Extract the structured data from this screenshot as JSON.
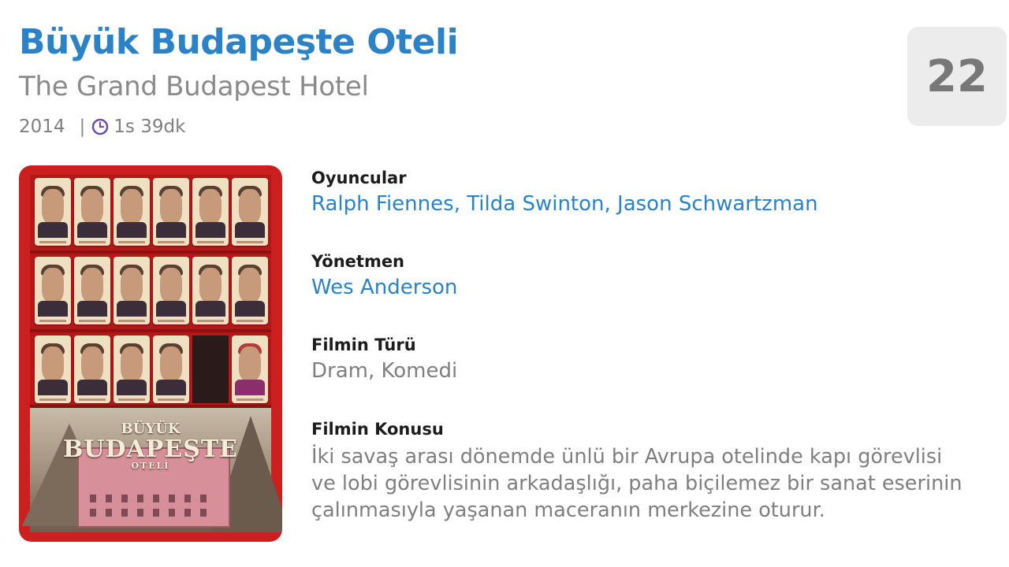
{
  "movie": {
    "title": "Büyük Budapeşte Oteli",
    "original_title": "The Grand Budapest Hotel",
    "year": "2014",
    "separator": "|",
    "duration": "1s 39dk",
    "score": "22"
  },
  "poster": {
    "title_line1": "BÜYÜK",
    "title_line2": "BUDAPEŞTE",
    "title_line3": "OTELİ"
  },
  "details": {
    "cast_label": "Oyuncular",
    "cast": [
      {
        "name": "Ralph Fiennes"
      },
      {
        "name": "Tilda Swinton"
      },
      {
        "name": "Jason Schwartzman"
      }
    ],
    "cast_separator": ", ",
    "director_label": "Yönetmen",
    "director": "Wes Anderson",
    "genre_label": "Filmin Türü",
    "genre": "Dram, Komedi",
    "plot_label": "Filmin Konusu",
    "plot_lines": [
      "İki savaş arası dönemde ünlü bir Avrupa otelinde kapı görevlisi",
      "ve lobi görevlisinin arkadaşlığı, paha biçilemez bir sanat eserinin",
      "çalınmasıyla yaşanan maceranın merkezine oturur."
    ]
  },
  "colors": {
    "accent": "#2b82c6",
    "muted_text": "#7f7f7f",
    "poster_red": "#cc1f1f",
    "score_bg": "#ececec",
    "clock_icon": "#6a4fa3"
  },
  "icons": {
    "duration": "clock-icon"
  }
}
